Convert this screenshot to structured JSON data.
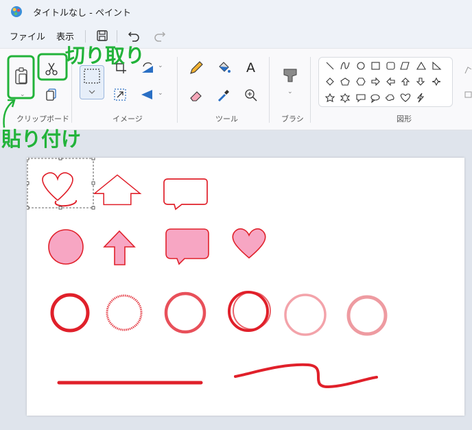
{
  "window": {
    "title": "タイトルなし - ペイント"
  },
  "menu": {
    "file": "ファイル",
    "view": "表示"
  },
  "ribbon": {
    "clipboard_label": "クリップボード",
    "image_label": "イメージ",
    "tools_label": "ツール",
    "brush_label": "ブラシ",
    "shapes_label": "図形",
    "text_tool_glyph": "A"
  },
  "annotations": {
    "cut": "切り取り",
    "paste": "貼り付け"
  },
  "colors": {
    "accent": "#e0202a",
    "pink_fill": "#f7a6c3",
    "highlight": "#22b33a"
  }
}
